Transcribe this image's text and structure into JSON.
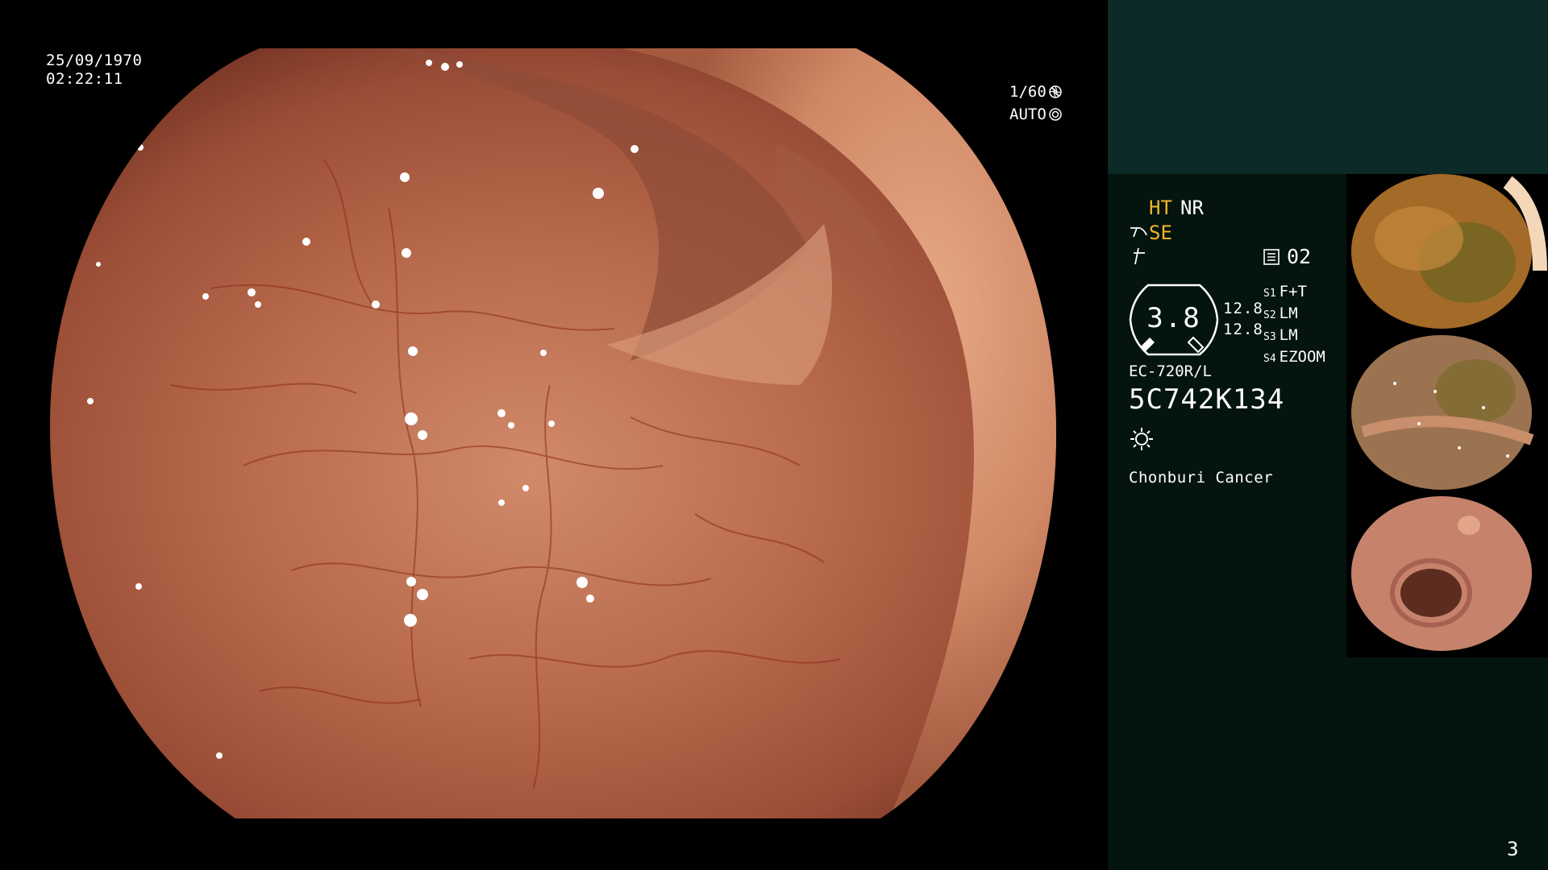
{
  "osd": {
    "date": "25/09/1970",
    "time": "02:22:11",
    "shutter": "1/60",
    "iris": "AUTO"
  },
  "panel": {
    "mode_ht": "HT",
    "mode_nr": "NR",
    "mode_se": "SE",
    "index_number": "02",
    "gauge_value": "3.8",
    "gauge_aux_1": "12.8",
    "gauge_aux_2": "12.8",
    "settings": [
      {
        "key": "S1",
        "value": "F+T"
      },
      {
        "key": "S2",
        "value": "LM"
      },
      {
        "key": "S3",
        "value": "LM"
      },
      {
        "key": "S4",
        "value": "EZOOM"
      }
    ],
    "scope_model": "EC-720R/L",
    "serial": "5C742K134",
    "institution": "Chonburi Cancer"
  },
  "thumbnails": [
    {
      "name": "capture-thumbnail-1",
      "tone": "#b07a2c"
    },
    {
      "name": "capture-thumbnail-2",
      "tone": "#a87a55"
    },
    {
      "name": "capture-thumbnail-3",
      "tone": "#c6826a"
    }
  ],
  "page_number": "3",
  "colors": {
    "panel_bg": "#04140f",
    "panel_top_bg": "#0c2a28",
    "highlight": "#f0b428",
    "mucosa": "#c27a5c"
  },
  "icons": [
    "shutter-icon",
    "iris-icon",
    "structure-enhance-icon",
    "color-icon",
    "record-icon",
    "light-source-icon"
  ]
}
